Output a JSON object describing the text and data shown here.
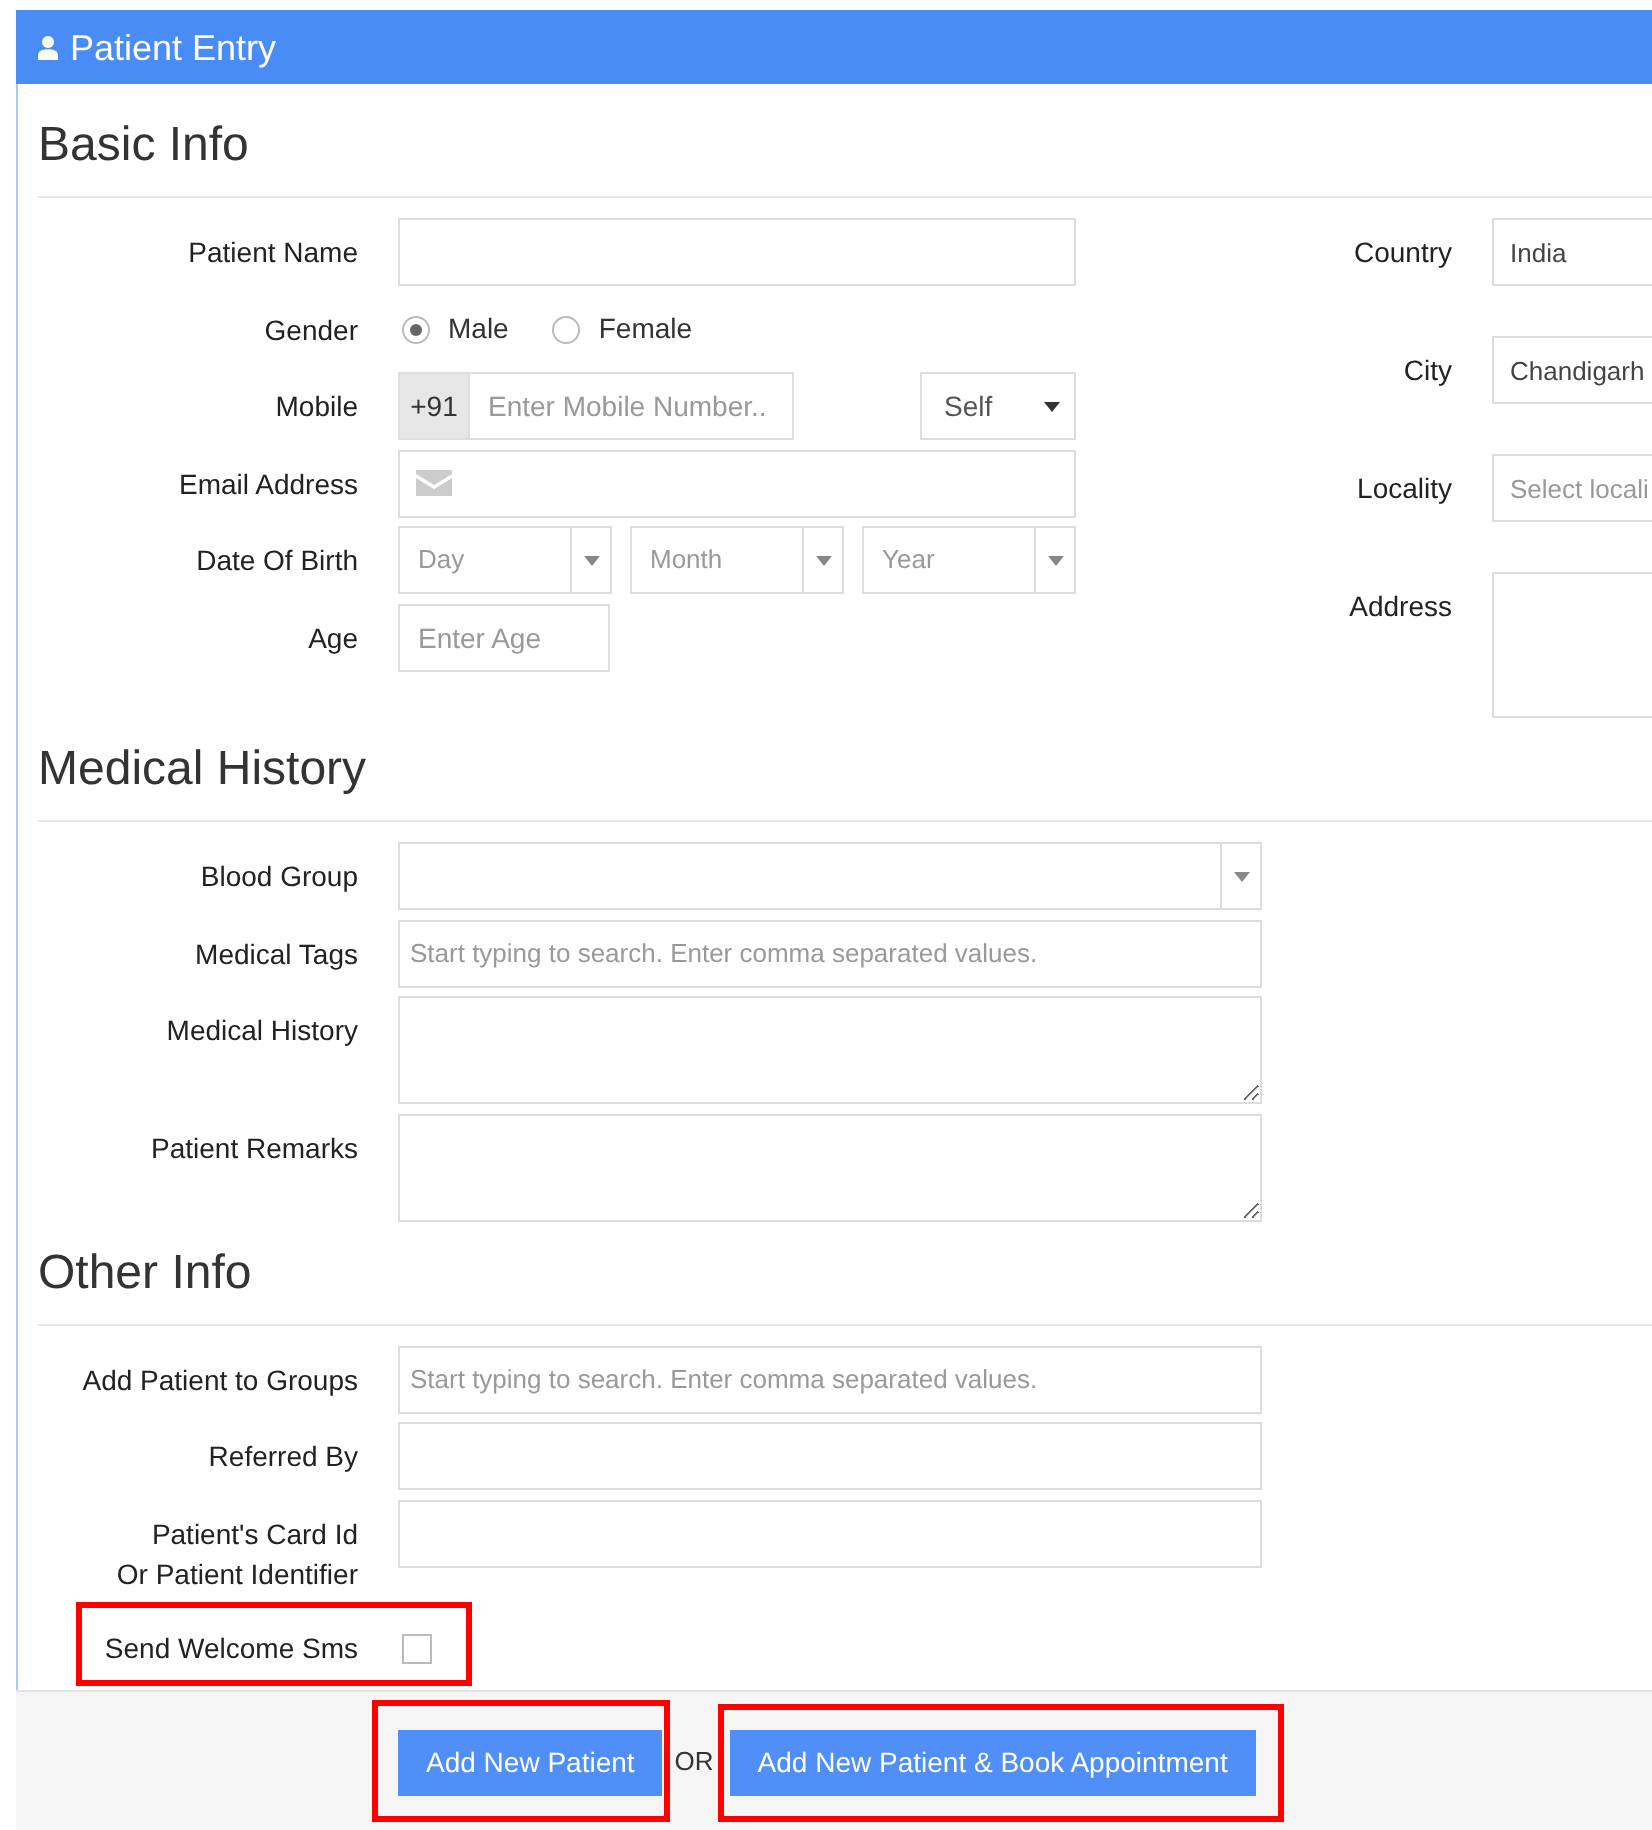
{
  "header": {
    "title": "Patient Entry"
  },
  "sections": [
    {
      "title": "Basic Info",
      "fields": [
        {
          "kind": "text",
          "label": "Patient Name"
        },
        {
          "kind": "radio",
          "label": "Gender",
          "options": [
            {
              "label": "Male",
              "selected": true
            },
            {
              "label": "Female",
              "selected": false
            }
          ]
        },
        {
          "kind": "phone",
          "label": "Mobile",
          "prefix": "+91",
          "placeholder": "Enter Mobile Number..",
          "relation": "Self"
        },
        {
          "kind": "email",
          "label": "Email Address"
        },
        {
          "kind": "date",
          "label": "Date Of Birth",
          "parts": [
            {
              "placeholder": "Day"
            },
            {
              "placeholder": "Month"
            },
            {
              "placeholder": "Year"
            }
          ]
        },
        {
          "kind": "number",
          "label": "Age",
          "placeholder": "Enter Age"
        }
      ],
      "side_fields": [
        {
          "kind": "text",
          "label": "Country",
          "value": "India"
        },
        {
          "kind": "text",
          "label": "City",
          "value": "Chandigarh"
        },
        {
          "kind": "text",
          "label": "Locality",
          "placeholder": "Select locali"
        },
        {
          "kind": "textarea",
          "label": "Address"
        }
      ]
    },
    {
      "title": "Medical History",
      "fields": [
        {
          "kind": "select",
          "label": "Blood Group"
        },
        {
          "kind": "text",
          "label": "Medical Tags",
          "placeholder": "Start typing to search. Enter comma separated values."
        },
        {
          "kind": "textarea",
          "label": "Medical History"
        },
        {
          "kind": "textarea",
          "label": "Patient Remarks"
        }
      ]
    },
    {
      "title": "Other Info",
      "fields": [
        {
          "kind": "text",
          "label": "Add Patient to Groups",
          "placeholder": "Start typing to search. Enter comma separated values."
        },
        {
          "kind": "text",
          "label": "Referred By"
        },
        {
          "kind": "text",
          "label": "Patient's Card Id\nOr Patient Identifier"
        },
        {
          "kind": "checkbox",
          "label": "Send Welcome Sms",
          "checked": false,
          "highlighted": true
        }
      ]
    }
  ],
  "footer": {
    "buttons": [
      {
        "label": "Add New Patient",
        "highlighted": true
      },
      {
        "label": "Add New Patient & Book Appointment",
        "highlighted": true
      }
    ],
    "separator": "OR"
  }
}
